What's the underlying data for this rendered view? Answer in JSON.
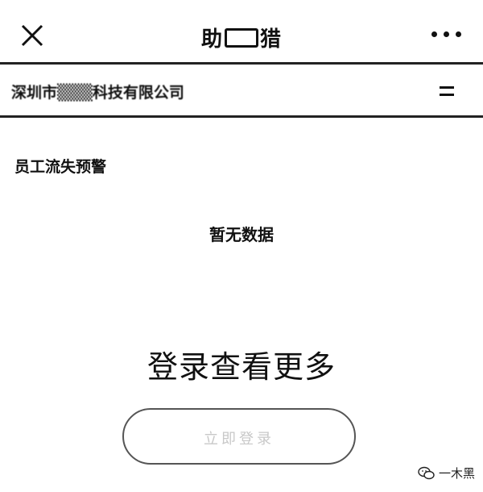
{
  "window": {
    "title_left": "助",
    "title_right": "猎",
    "close_icon": "close-icon",
    "more_icon": "more-dots-icon"
  },
  "company": {
    "name": "深圳市▒▒▒科技有限公司",
    "menu_icon": "menu-icon"
  },
  "section": {
    "title": "员工流失预警",
    "empty_text": "暂无数据"
  },
  "login": {
    "heading": "登录查看更多",
    "button_label": "立即登录"
  },
  "watermark": {
    "text": "一木黑",
    "icon": "wechat-icon"
  }
}
